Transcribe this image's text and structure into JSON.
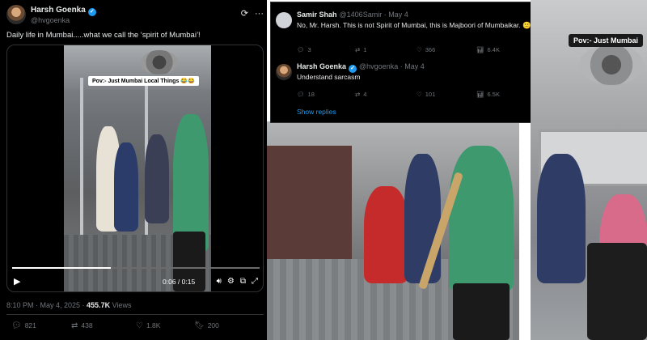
{
  "tweet": {
    "author_name": "Harsh Goenka",
    "author_handle": "@hvgoenka",
    "text": "Daily life in Mumbai.....what we call the ‘spirit of Mumbai’!",
    "video": {
      "caption": "Pov:- Just Mumbai Local Things 😂😂",
      "time": "0:06 / 0:15",
      "progress": 0.4
    },
    "timestamp": "8:10 PM · May 4, 2025 · ",
    "views_count": "455.7K",
    "views_label": "Views",
    "actions": {
      "replies": "821",
      "reposts": "438",
      "likes": "1.8K",
      "bookmarks": "200"
    }
  },
  "replies": [
    {
      "name": "Samir Shah",
      "meta": "@1406Samir · May 4",
      "text": "No, Mr. Harsh. This is not Spirit of Mumbai, this is Majboori of Mumbaikar. 😕",
      "stats": {
        "replies": "3",
        "reposts": "1",
        "likes": "366",
        "views": "6.4K"
      }
    },
    {
      "name": "Harsh Goenka",
      "meta": "@hvgoenka · May 4",
      "text": "Understand sarcasm",
      "stats": {
        "replies": "18",
        "reposts": "4",
        "likes": "101",
        "views": "6.5K"
      }
    }
  ],
  "show_replies": "Show replies",
  "right_caption": "Pov:- Just Mumbai",
  "colors": {
    "accent": "#1d9bf0",
    "background": "#000000",
    "muted": "#71767b"
  }
}
